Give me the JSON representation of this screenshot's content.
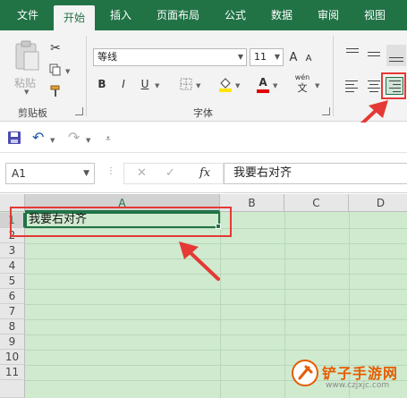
{
  "ribbon": {
    "tabs": [
      {
        "label": "文件",
        "active": false
      },
      {
        "label": "开始",
        "active": true
      },
      {
        "label": "插入",
        "active": false
      },
      {
        "label": "页面布局",
        "active": false
      },
      {
        "label": "公式",
        "active": false
      },
      {
        "label": "数据",
        "active": false
      },
      {
        "label": "审阅",
        "active": false
      },
      {
        "label": "视图",
        "active": false
      }
    ],
    "clipboard": {
      "paste_label": "粘贴",
      "group_label": "剪贴板"
    },
    "font": {
      "font_name": "等线",
      "font_size": "11",
      "bold": "B",
      "italic": "I",
      "underline": "U",
      "font_color_letter": "A",
      "phonetic_top": "wén",
      "phonetic_bottom": "文",
      "grow_font": "A",
      "shrink_font": "A",
      "group_label": "字体",
      "highlight_color": "#ffe600",
      "font_color": "#e00000"
    },
    "alignment": {
      "active": "align-right"
    }
  },
  "formula_bar": {
    "name_box": "A1",
    "cancel_symbol": "✕",
    "enter_symbol": "✓",
    "fx_label": "fx",
    "content": "我要右对齐"
  },
  "sheet": {
    "columns": [
      "A",
      "B",
      "C",
      "D"
    ],
    "selected_column": "A",
    "rows": [
      "1",
      "2",
      "3",
      "4",
      "5",
      "6",
      "7",
      "8",
      "9",
      "10",
      "11"
    ],
    "selected_row": "1",
    "cell_a1": "我要右对齐"
  },
  "watermark": {
    "title": "铲子手游网",
    "url": "www.czjxjc.com"
  },
  "colors": {
    "accent": "#217346",
    "sheet_fill": "#cfeacf",
    "annotation_red": "#e53935"
  }
}
